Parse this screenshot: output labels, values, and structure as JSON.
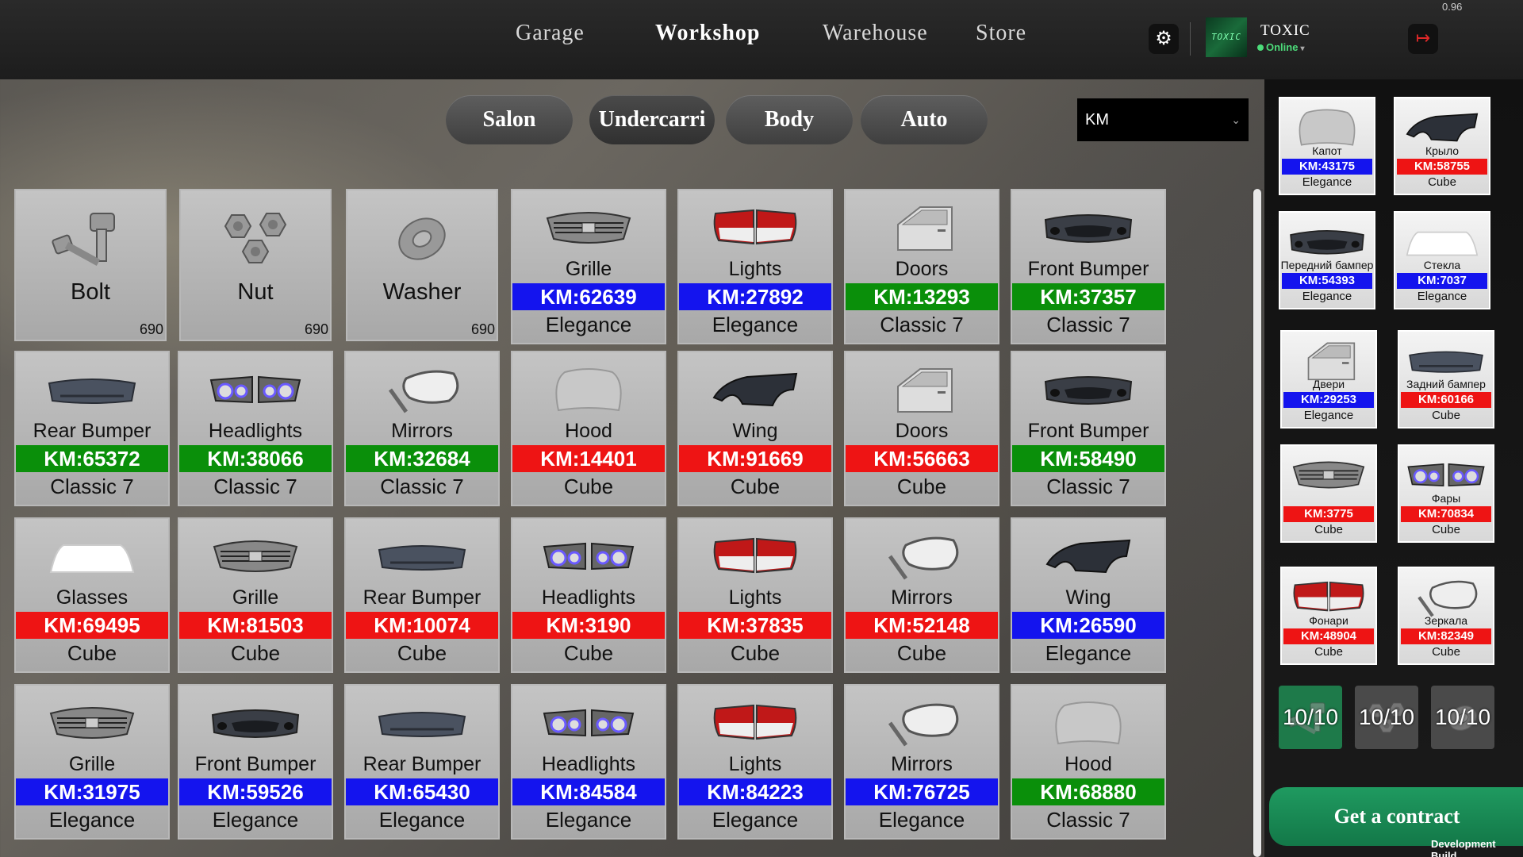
{
  "nav": {
    "garage": "Garage",
    "workshop": "Workshop",
    "warehouse": "Warehouse",
    "store": "Store"
  },
  "user": {
    "avatar_text": "TOXIC",
    "name": "TOXIC",
    "status": "Online"
  },
  "version": "0.96",
  "tabs": {
    "salon": "Salon",
    "undercarriage": "Undercarri",
    "body": "Body",
    "auto": "Auto"
  },
  "filter": {
    "value": "KM"
  },
  "colors": {
    "blue": "#1414ee",
    "red": "#ee1414",
    "green": "#0a8f0a",
    "accent": "#1f9a60"
  },
  "basic_parts": [
    {
      "name": "Bolt",
      "count": "690",
      "icon": "bolt-icon"
    },
    {
      "name": "Nut",
      "count": "690",
      "icon": "nut-icon"
    },
    {
      "name": "Washer",
      "count": "690",
      "icon": "washer-icon"
    }
  ],
  "parts": [
    {
      "name": "Grille",
      "km": "KM:62639",
      "color": "blue",
      "variant": "Elegance",
      "icon": "grille"
    },
    {
      "name": "Lights",
      "km": "KM:27892",
      "color": "blue",
      "variant": "Elegance",
      "icon": "lights"
    },
    {
      "name": "Doors",
      "km": "KM:13293",
      "color": "green",
      "variant": "Classic 7",
      "icon": "door"
    },
    {
      "name": "Front Bumper",
      "km": "KM:37357",
      "color": "green",
      "variant": "Classic 7",
      "icon": "fbumper"
    },
    {
      "name": "Rear Bumper",
      "km": "KM:65372",
      "color": "green",
      "variant": "Classic 7",
      "icon": "rbumper"
    },
    {
      "name": "Headlights",
      "km": "KM:38066",
      "color": "green",
      "variant": "Classic 7",
      "icon": "headlights"
    },
    {
      "name": "Mirrors",
      "km": "KM:32684",
      "color": "green",
      "variant": "Classic 7",
      "icon": "mirror"
    },
    {
      "name": "Hood",
      "km": "KM:14401",
      "color": "red",
      "variant": "Cube",
      "icon": "hood"
    },
    {
      "name": "Wing",
      "km": "KM:91669",
      "color": "red",
      "variant": "Cube",
      "icon": "wing"
    },
    {
      "name": "Doors",
      "km": "KM:56663",
      "color": "red",
      "variant": "Cube",
      "icon": "door"
    },
    {
      "name": "Front Bumper",
      "km": "KM:58490",
      "color": "green",
      "variant": "Classic 7",
      "icon": "fbumper"
    },
    {
      "name": "Glasses",
      "km": "KM:69495",
      "color": "red",
      "variant": "Cube",
      "icon": "glass"
    },
    {
      "name": "Grille",
      "km": "KM:81503",
      "color": "red",
      "variant": "Cube",
      "icon": "grille"
    },
    {
      "name": "Rear Bumper",
      "km": "KM:10074",
      "color": "red",
      "variant": "Cube",
      "icon": "rbumper"
    },
    {
      "name": "Headlights",
      "km": "KM:3190",
      "color": "red",
      "variant": "Cube",
      "icon": "headlights"
    },
    {
      "name": "Lights",
      "km": "KM:37835",
      "color": "red",
      "variant": "Cube",
      "icon": "lights"
    },
    {
      "name": "Mirrors",
      "km": "KM:52148",
      "color": "red",
      "variant": "Cube",
      "icon": "mirror"
    },
    {
      "name": "Wing",
      "km": "KM:26590",
      "color": "blue",
      "variant": "Elegance",
      "icon": "wing"
    },
    {
      "name": "Grille",
      "km": "KM:31975",
      "color": "blue",
      "variant": "Elegance",
      "icon": "grille"
    },
    {
      "name": "Front Bumper",
      "km": "KM:59526",
      "color": "blue",
      "variant": "Elegance",
      "icon": "fbumper"
    },
    {
      "name": "Rear Bumper",
      "km": "KM:65430",
      "color": "blue",
      "variant": "Elegance",
      "icon": "rbumper"
    },
    {
      "name": "Headlights",
      "km": "KM:84584",
      "color": "blue",
      "variant": "Elegance",
      "icon": "headlights"
    },
    {
      "name": "Lights",
      "km": "KM:84223",
      "color": "blue",
      "variant": "Elegance",
      "icon": "lights"
    },
    {
      "name": "Mirrors",
      "km": "KM:76725",
      "color": "blue",
      "variant": "Elegance",
      "icon": "mirror"
    },
    {
      "name": "Hood",
      "km": "KM:68880",
      "color": "green",
      "variant": "Classic 7",
      "icon": "hood"
    }
  ],
  "required": [
    {
      "name": "Капот",
      "km": "KM:43175",
      "color": "blue",
      "variant": "Elegance",
      "icon": "hood"
    },
    {
      "name": "Крыло",
      "km": "KM:58755",
      "color": "red",
      "variant": "Cube",
      "icon": "wing"
    },
    {
      "name": "Передний бампер",
      "km": "KM:54393",
      "color": "blue",
      "variant": "Elegance",
      "icon": "fbumper"
    },
    {
      "name": "Стекла",
      "km": "KM:7037",
      "color": "blue",
      "variant": "Elegance",
      "icon": "glass"
    },
    {
      "name": "Двери",
      "km": "KM:29253",
      "color": "blue",
      "variant": "Elegance",
      "icon": "door"
    },
    {
      "name": "Задний бампер",
      "km": "KM:60166",
      "color": "red",
      "variant": "Cube",
      "icon": "rbumper"
    },
    {
      "name": "",
      "km": "KM:3775",
      "color": "red",
      "variant": "Cube",
      "icon": "grille"
    },
    {
      "name": "Фары",
      "km": "KM:70834",
      "color": "red",
      "variant": "Cube",
      "icon": "headlights"
    },
    {
      "name": "Фонари",
      "km": "KM:48904",
      "color": "red",
      "variant": "Cube",
      "icon": "lights"
    },
    {
      "name": "Зеркала",
      "km": "KM:82349",
      "color": "red",
      "variant": "Cube",
      "icon": "mirror"
    }
  ],
  "slots": [
    {
      "label": "10/10",
      "icon": "bolt-icon"
    },
    {
      "label": "10/10",
      "icon": "nut-icon"
    },
    {
      "label": "10/10",
      "icon": "washer-icon"
    }
  ],
  "contract_button": "Get a contract",
  "dev_build": "Development Build"
}
